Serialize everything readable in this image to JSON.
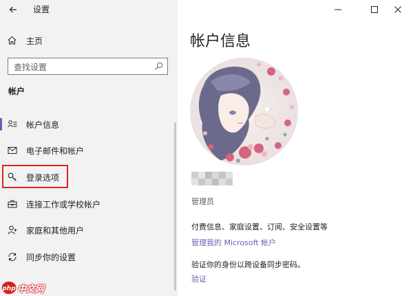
{
  "window": {
    "app_title": "设置",
    "back_icon": "arrow-left-icon",
    "controls": [
      "minimize-icon",
      "maximize-icon",
      "close-icon"
    ]
  },
  "sidebar": {
    "home_label": "主页",
    "search_placeholder": "查找设置",
    "section_title": "帐户",
    "items": [
      {
        "label": "帐户信息",
        "icon": "account-info-icon",
        "selected": true
      },
      {
        "label": "电子邮件和帐户",
        "icon": "mail-icon",
        "selected": false
      },
      {
        "label": "登录选项",
        "icon": "key-icon",
        "selected": false,
        "highlighted": true
      },
      {
        "label": "连接工作或学校帐户",
        "icon": "briefcase-icon",
        "selected": false
      },
      {
        "label": "家庭和其他用户",
        "icon": "person-add-icon",
        "selected": false
      },
      {
        "label": "同步你的设置",
        "icon": "sync-icon",
        "selected": false
      }
    ]
  },
  "main": {
    "title": "帐户信息",
    "role": "管理员",
    "billing_text": "付费信息、家庭设置、订阅、安全设置等",
    "manage_link": "管理我的 Microsoft 帐户",
    "verify_text": "验证你的身份以跨设备同步密码。",
    "verify_link": "验证"
  },
  "watermark": {
    "text": "中文网"
  },
  "colors": {
    "accent": "#6b5fb5",
    "highlight": "#e02020",
    "sidebar_bg": "#f2f2f2"
  }
}
